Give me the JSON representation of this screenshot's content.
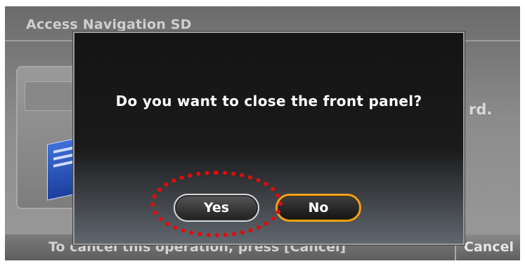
{
  "background": {
    "title": "Access Navigation SD",
    "side_text": "rd.",
    "hint": "To cancel this operation, press [Cancel]",
    "cancel_label": "Cancel"
  },
  "dialog": {
    "message": "Do you want to close the front panel?",
    "yes_label": "Yes",
    "no_label": "No"
  },
  "colors": {
    "focus_outline": "#f0a21a",
    "annotation_dots": "#e40b0b"
  },
  "icons": [
    "sd-card-icon",
    "device-illustration"
  ]
}
